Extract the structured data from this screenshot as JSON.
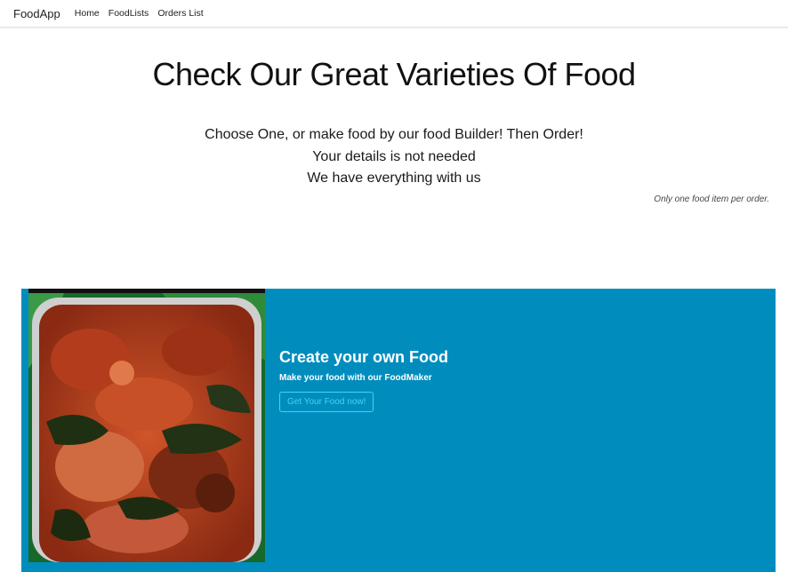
{
  "navbar": {
    "brand": "FoodApp",
    "links": [
      "Home",
      "FoodLists",
      "Orders List"
    ]
  },
  "hero": {
    "title": "Check Our Great Varieties Of Food",
    "line1": "Choose One, or make food by our food Builder! Then Order!",
    "line2": "Your details is not needed",
    "line3": "We have everything with us",
    "note": "Only one food item per order."
  },
  "card": {
    "title": "Create your own Food",
    "text": "Make your food with our FoodMaker",
    "button": "Get Your Food now!"
  },
  "colors": {
    "card_background": "#008dbd",
    "button_outline": "#41d4f5"
  }
}
